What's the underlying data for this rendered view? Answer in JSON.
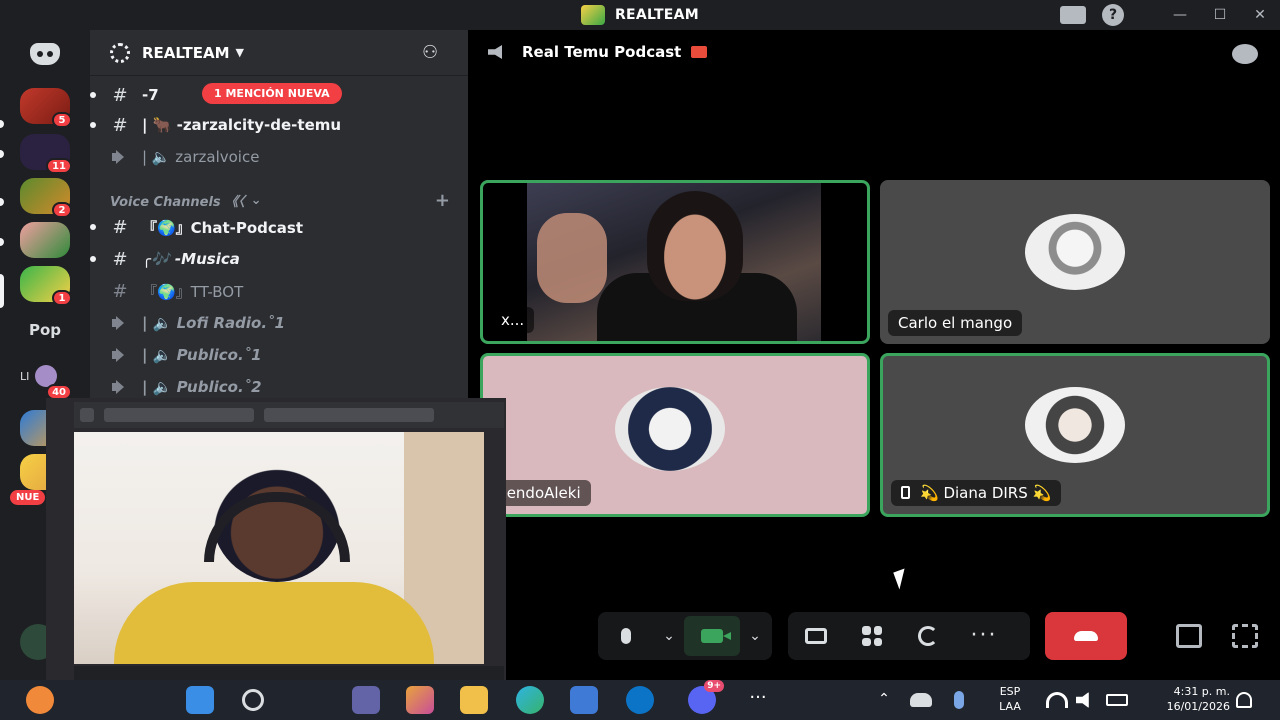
{
  "window": {
    "title": "REALTEAM"
  },
  "rail": {
    "servers": [
      {
        "badge": "5"
      },
      {
        "badge": "11"
      },
      {
        "badge": "2"
      },
      {
        "badge": ""
      },
      {
        "badge": "1"
      }
    ],
    "folder_label": "Pop",
    "li_label": "LI",
    "li_badge": "40",
    "nuevo_label": "NUE"
  },
  "sidebar": {
    "server_name": "REALTEAM",
    "mention_pill": "1 MENCIÓN NUEVA",
    "channels_top": [
      {
        "name": "-7",
        "type": "text",
        "unread": true
      },
      {
        "name": "| 🐂 -zarzalcity-de-temu",
        "type": "text",
        "unread": true
      },
      {
        "name": "| 🔈 zarzalvoice",
        "type": "voice",
        "unread": false
      }
    ],
    "category": "Voice Channels 《〈",
    "channels_voice": [
      {
        "name": "『🌍』Chat-Podcast",
        "type": "text",
        "unread": true,
        "italic": false
      },
      {
        "name": "╭🎶 -Musica",
        "type": "text",
        "unread": true,
        "italic": true
      },
      {
        "name": "『🌍』TT-BOT",
        "type": "text",
        "unread": false,
        "italic": false
      },
      {
        "name": "| 🔈 Lofi Radio.˚1",
        "type": "voice",
        "unread": false,
        "italic": true
      },
      {
        "name": "| 🔈 Publico.˚1",
        "type": "voice",
        "unread": false,
        "italic": true
      },
      {
        "name": "| 🔈 Publico.˚2",
        "type": "voice",
        "unread": false,
        "italic": true
      }
    ]
  },
  "stage": {
    "channel_title": "Real Temu Podcast",
    "participants": [
      {
        "name": "x...",
        "speaking": true,
        "has_video": true
      },
      {
        "name": "Carlo el mango",
        "speaking": false,
        "has_video": false
      },
      {
        "name": "SiendoAleki",
        "speaking": true,
        "has_video": false
      },
      {
        "name": "💫 Diana DIRS 💫",
        "speaking": true,
        "has_video": false,
        "mobile": true
      }
    ]
  },
  "taskbar": {
    "discord_badge": "9+",
    "lang_line1": "ESP",
    "lang_line2": "LAA",
    "time": "4:31 p. m.",
    "date": "16/01/2026"
  },
  "colors": {
    "speaking_border": "#3ba55d",
    "mention_red": "#f23f43",
    "hangup_red": "#da373c"
  }
}
